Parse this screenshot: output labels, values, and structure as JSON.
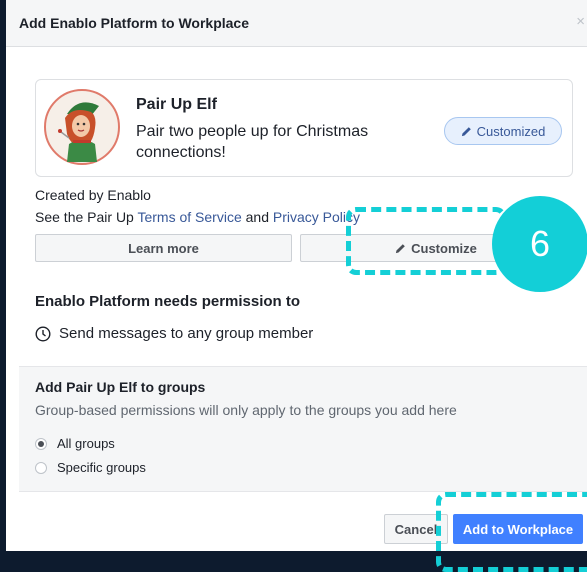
{
  "dialog": {
    "title": "Add Enablo Platform to Workplace",
    "close_label": "×"
  },
  "app_card": {
    "name": "Pair Up Elf",
    "description": "Pair two people up for Christmas connections!",
    "badge_label": "Customized"
  },
  "info": {
    "created_by": "Created by Enablo",
    "see_prefix": "See the Pair Up ",
    "terms_link": "Terms of Service",
    "and_text": " and ",
    "privacy_link": "Privacy Policy"
  },
  "buttons": {
    "learn_more": "Learn more",
    "customize": "Customize",
    "cancel": "Cancel",
    "add_to_workplace": "Add to Workplace"
  },
  "permissions": {
    "title": "Enablo Platform needs permission to",
    "items": [
      "Send messages to any group member"
    ]
  },
  "groups": {
    "title": "Add Pair Up Elf to groups",
    "subtitle": "Group-based permissions will only apply to the groups you add here",
    "options": [
      {
        "label": "All groups",
        "selected": true
      },
      {
        "label": "Specific groups",
        "selected": false
      }
    ]
  },
  "overlay": {
    "step_number": "6",
    "accent_color": "#14cfd6"
  },
  "colors": {
    "primary": "#4080ff",
    "link": "#385898"
  }
}
